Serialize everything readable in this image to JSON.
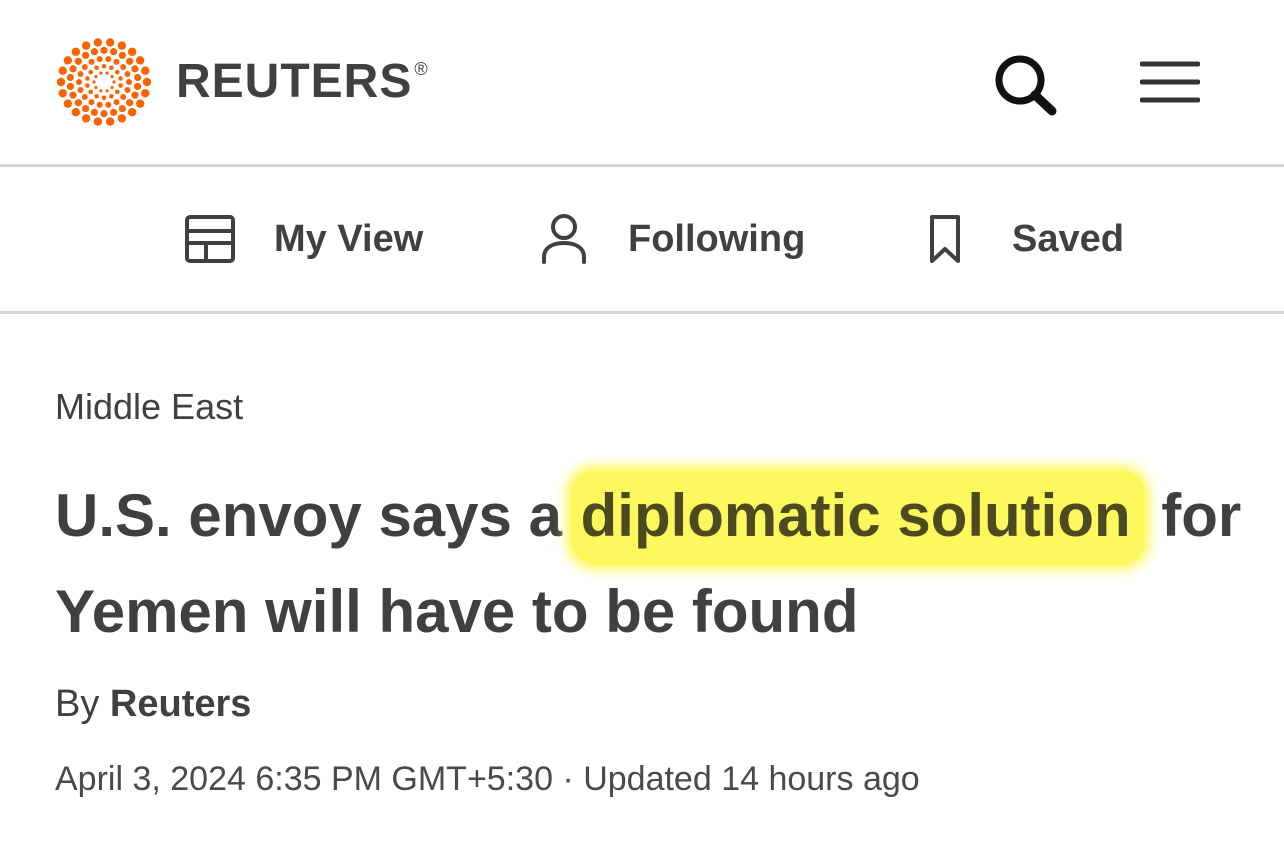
{
  "header": {
    "brand": "REUTERS",
    "brand_mark": "®",
    "icons": {
      "logo": "reuters-dot-logo",
      "search": "search-icon",
      "menu": "hamburger-menu-icon"
    },
    "brand_color": "#fa6400"
  },
  "nav": {
    "items": [
      {
        "label": "My View",
        "icon": "layout-icon"
      },
      {
        "label": "Following",
        "icon": "person-icon"
      },
      {
        "label": "Saved",
        "icon": "bookmark-icon"
      }
    ]
  },
  "article": {
    "section": "Middle East",
    "headline_before": "U.S. envoy says a ",
    "headline_highlight": "diplomatic solution",
    "headline_after": " for Yemen will have to be found",
    "highlight_color": "#fdf85e",
    "byline_prefix": "By",
    "byline_author": "Reuters",
    "dateline": "April 3, 2024 6:35 PM GMT+5:30 · Updated 14 hours ago"
  }
}
